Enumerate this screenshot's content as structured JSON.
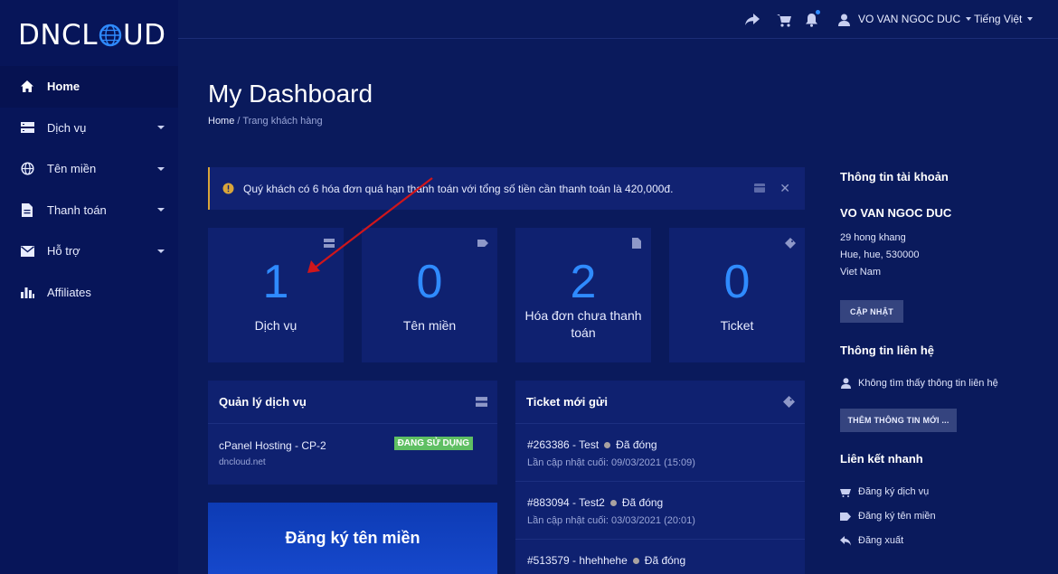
{
  "brand": {
    "logo_left": "DNCL",
    "logo_right": "UD"
  },
  "sidebar": {
    "items": [
      {
        "label": "Home",
        "icon": "home-icon"
      },
      {
        "label": "Dịch vụ",
        "icon": "server-icon"
      },
      {
        "label": "Tên miền",
        "icon": "globe-icon"
      },
      {
        "label": "Thanh toán",
        "icon": "document-icon"
      },
      {
        "label": "Hỗ trợ",
        "icon": "envelope-icon"
      },
      {
        "label": "Affiliates",
        "icon": "bar-chart-icon"
      }
    ]
  },
  "topbar": {
    "user_name": "VO VAN NGOC DUC",
    "language": "Tiếng Việt",
    "icons": [
      "share-icon",
      "cart-icon",
      "bell-icon",
      "user-icon"
    ]
  },
  "page": {
    "title": "My Dashboard",
    "breadcrumb_home": "Home",
    "breadcrumb_sep": "/",
    "breadcrumb_current": "Trang khách hàng"
  },
  "alert": {
    "text": "Quý khách có 6 hóa đơn quá hạn thanh toán với tổng số tiền cần thanh toán là 420,000đ."
  },
  "stats": [
    {
      "value": "1",
      "label": "Dịch vụ",
      "icon": "server-icon"
    },
    {
      "value": "0",
      "label": "Tên miền",
      "icon": "tag-icon"
    },
    {
      "value": "2",
      "label": "Hóa đơn chưa thanh toán",
      "icon": "file-icon"
    },
    {
      "value": "0",
      "label": "Ticket",
      "icon": "ticket-icon"
    }
  ],
  "services_panel": {
    "title": "Quản lý dịch vụ",
    "items": [
      {
        "name": "cPanel Hosting - CP-2",
        "domain": "dncloud.net",
        "status": "ĐANG SỬ DỤNG"
      }
    ]
  },
  "tickets_panel": {
    "title": "Ticket mới gửi",
    "items": [
      {
        "id": "#263386 - Test",
        "status": "Đã đóng",
        "updated": "Lần cập nhật cuối: 09/03/2021 (15:09)"
      },
      {
        "id": "#883094 - Test2",
        "status": "Đã đóng",
        "updated": "Lần cập nhật cuối: 03/03/2021 (20:01)"
      },
      {
        "id": "#513579 - hhehhehe",
        "status": "Đã đóng",
        "updated": ""
      }
    ]
  },
  "promo": {
    "label": "Đăng ký tên miền"
  },
  "account": {
    "heading": "Thông tin tài khoản",
    "name": "VO VAN NGOC DUC",
    "address1": "29 hong khang",
    "address2": "Hue, hue, 530000",
    "country": "Viet Nam",
    "update_button": "CẬP NHẬT"
  },
  "contact": {
    "heading": "Thông tin liên hệ",
    "empty_text": "Không tìm thấy thông tin liên hệ",
    "add_button": "THÊM THÔNG TIN MỚI ..."
  },
  "quick_links": {
    "heading": "Liên kết nhanh",
    "items": [
      {
        "label": "Đăng ký dịch vụ",
        "icon": "cart-icon"
      },
      {
        "label": "Đăng ký tên miền",
        "icon": "tag-icon"
      },
      {
        "label": "Đăng xuất",
        "icon": "back-arrow-icon"
      }
    ]
  },
  "colors": {
    "accent": "#2f8bff",
    "background": "#0a1a5c",
    "panel": "#0f2170",
    "badge": "#5fbf63",
    "annotation": "#d0161b"
  }
}
